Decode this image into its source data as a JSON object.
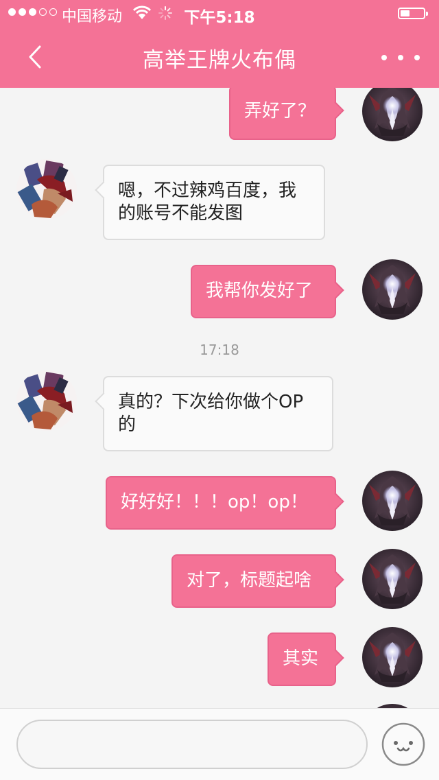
{
  "status": {
    "carrier": "中国移动",
    "time": "下午5:18",
    "battery_level": 0.4
  },
  "nav": {
    "title": "高举王牌火布偶",
    "back_icon": "chevron-left-icon",
    "more_icon": "more-dots-icon"
  },
  "chat": {
    "m1": "弄好了？",
    "m2": "嗯，不过辣鸡百度，我的账号不能发图",
    "m3": "我帮你发好了",
    "timestamp": "17:18",
    "m4": "真的？下次给你做个OP的",
    "m5": "好好好！！！op！op！",
    "m6": "对了，标题起啥",
    "m7": "其实"
  },
  "input": {
    "placeholder": "",
    "emoji_icon": "smiley-face-icon"
  },
  "colors": {
    "accent": "#f47296",
    "background": "#f4f4f4",
    "incoming_bubble": "#fafafa"
  }
}
